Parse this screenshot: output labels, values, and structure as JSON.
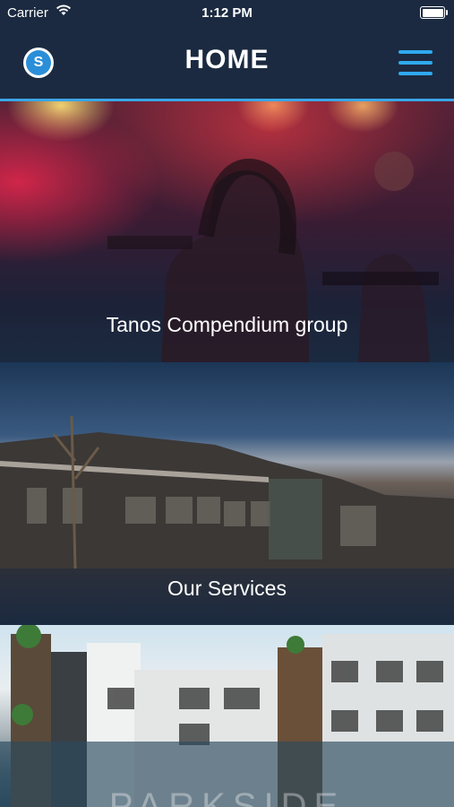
{
  "status_bar": {
    "carrier": "Carrier",
    "time": "1:12 PM"
  },
  "navbar": {
    "logo_letter": "S",
    "title": "HOME"
  },
  "cards": [
    {
      "label": "Tanos Compendium group"
    },
    {
      "label": "Our Services"
    },
    {
      "label": "",
      "image_text": "PARKSIDE"
    }
  ],
  "colors": {
    "nav_background": "#1b2a40",
    "accent": "#2fa9f0"
  }
}
